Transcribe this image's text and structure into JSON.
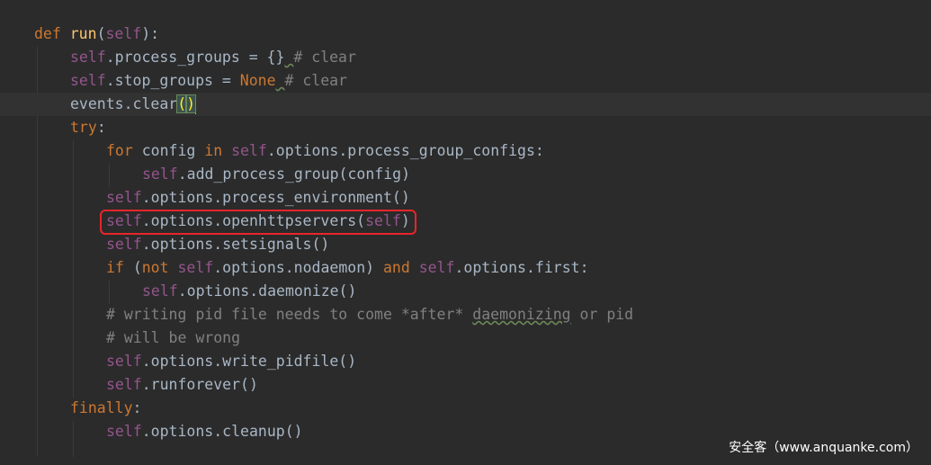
{
  "code": {
    "lines": [
      {
        "indent": 0,
        "tokens": [
          {
            "t": "def ",
            "c": "kw"
          },
          {
            "t": "run",
            "c": "fn"
          },
          {
            "t": "(",
            "c": ""
          },
          {
            "t": "self",
            "c": "self"
          },
          {
            "t": "):",
            "c": ""
          }
        ]
      },
      {
        "indent": 1,
        "tokens": [
          {
            "t": "self",
            "c": "self"
          },
          {
            "t": ".process_groups = {}",
            "c": ""
          },
          {
            "t": " ",
            "c": "uline"
          },
          {
            "t": "# clear",
            "c": "cm"
          }
        ]
      },
      {
        "indent": 1,
        "tokens": [
          {
            "t": "self",
            "c": "self"
          },
          {
            "t": ".stop_groups = ",
            "c": ""
          },
          {
            "t": "None",
            "c": "kw"
          },
          {
            "t": " ",
            "c": "uline"
          },
          {
            "t": "# clear",
            "c": "cm"
          }
        ]
      },
      {
        "indent": 1,
        "current": true,
        "tokens": [
          {
            "t": "events.clear",
            "c": ""
          },
          {
            "t": "(",
            "c": "bracket-match"
          },
          {
            "t": ")",
            "c": "bracket-match"
          }
        ]
      },
      {
        "indent": 1,
        "tokens": [
          {
            "t": "try",
            "c": "kw"
          },
          {
            "t": ":",
            "c": ""
          }
        ]
      },
      {
        "indent": 2,
        "tokens": [
          {
            "t": "for ",
            "c": "kw"
          },
          {
            "t": "config ",
            "c": ""
          },
          {
            "t": "in ",
            "c": "kw"
          },
          {
            "t": "self",
            "c": "self"
          },
          {
            "t": ".options.process_group_configs:",
            "c": ""
          }
        ]
      },
      {
        "indent": 3,
        "tokens": [
          {
            "t": "self",
            "c": "self"
          },
          {
            "t": ".add_process_group(config)",
            "c": ""
          }
        ]
      },
      {
        "indent": 2,
        "tokens": [
          {
            "t": "self",
            "c": "self"
          },
          {
            "t": ".options.process_environment()",
            "c": ""
          }
        ]
      },
      {
        "indent": 2,
        "tokens": [
          {
            "t": "self",
            "c": "self"
          },
          {
            "t": ".options.openhttpservers(",
            "c": ""
          },
          {
            "t": "self",
            "c": "self"
          },
          {
            "t": ")",
            "c": ""
          }
        ]
      },
      {
        "indent": 2,
        "tokens": [
          {
            "t": "self",
            "c": "self"
          },
          {
            "t": ".options.setsignals()",
            "c": ""
          }
        ]
      },
      {
        "indent": 2,
        "tokens": [
          {
            "t": "if ",
            "c": "kw"
          },
          {
            "t": "(",
            "c": ""
          },
          {
            "t": "not ",
            "c": "kw"
          },
          {
            "t": "self",
            "c": "self"
          },
          {
            "t": ".options.nodaemon) ",
            "c": ""
          },
          {
            "t": "and ",
            "c": "kw"
          },
          {
            "t": "self",
            "c": "self"
          },
          {
            "t": ".options.first:",
            "c": ""
          }
        ]
      },
      {
        "indent": 3,
        "tokens": [
          {
            "t": "self",
            "c": "self"
          },
          {
            "t": ".options.daemonize()",
            "c": ""
          }
        ]
      },
      {
        "indent": 2,
        "tokens": [
          {
            "t": "# writing pid file needs to come *after* ",
            "c": "cm"
          },
          {
            "t": "daemonizing",
            "c": "cm uline"
          },
          {
            "t": " or pid",
            "c": "cm"
          }
        ]
      },
      {
        "indent": 2,
        "tokens": [
          {
            "t": "# will be wrong",
            "c": "cm"
          }
        ]
      },
      {
        "indent": 2,
        "tokens": [
          {
            "t": "self",
            "c": "self"
          },
          {
            "t": ".options.write_pidfile()",
            "c": ""
          }
        ]
      },
      {
        "indent": 2,
        "tokens": [
          {
            "t": "self",
            "c": "self"
          },
          {
            "t": ".runforever()",
            "c": ""
          }
        ]
      },
      {
        "indent": 1,
        "tokens": [
          {
            "t": "finally",
            "c": "kw"
          },
          {
            "t": ":",
            "c": ""
          }
        ]
      },
      {
        "indent": 2,
        "tokens": [
          {
            "t": "self",
            "c": "self"
          },
          {
            "t": ".options.cleanup()",
            "c": ""
          }
        ]
      }
    ]
  },
  "watermark": "安全客（www.anquanke.com）",
  "colors": {
    "background": "#2b2b2b",
    "keyword": "#cc7832",
    "function": "#ffc66d",
    "self": "#94558d",
    "comment": "#808080",
    "text": "#a9b7c6",
    "highlight_box": "#e8252a"
  }
}
